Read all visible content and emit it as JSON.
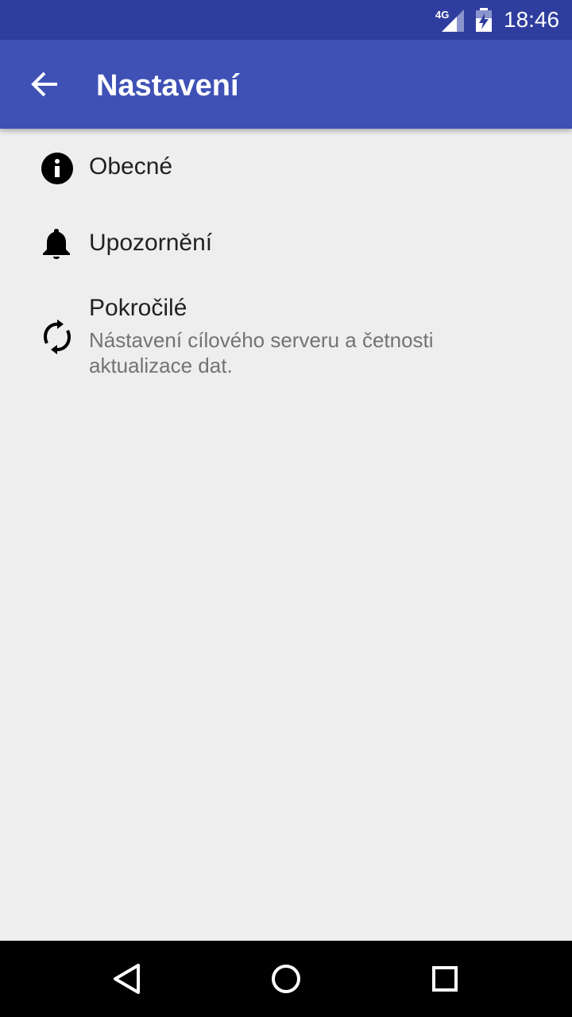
{
  "status_bar": {
    "network": "4G",
    "time": "18:46"
  },
  "app_bar": {
    "title": "Nastavení",
    "back_icon": "arrow-back-icon"
  },
  "preferences": [
    {
      "icon": "info-icon",
      "title": "Obecné"
    },
    {
      "icon": "bell-icon",
      "title": "Upozornění"
    },
    {
      "icon": "sync-icon",
      "title": "Pokročilé",
      "summary": "Nástavení cílového serveru a četnosti aktualizace dat."
    }
  ],
  "nav_bar": {
    "back": "triangle-back-icon",
    "home": "circle-home-icon",
    "recents": "square-recents-icon"
  },
  "colors": {
    "status_bar": "#2f3e9e",
    "app_bar": "#3f51b5",
    "background": "#eeeeee"
  }
}
